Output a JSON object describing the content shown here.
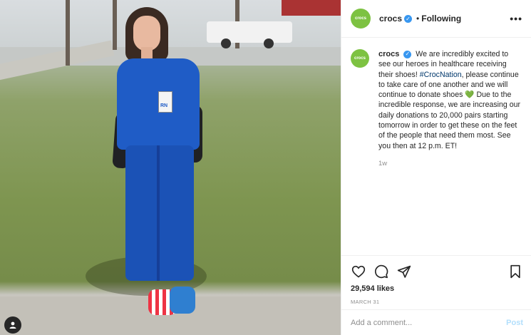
{
  "post": {
    "account": {
      "avatar_text": "crocs",
      "username": "crocs",
      "verified_glyph": "✓",
      "separator": "•",
      "follow_status": "Following"
    },
    "menu_glyph": "•••",
    "caption": {
      "username": "crocs",
      "text_before": "We are incredibly excited to see our heroes in healthcare receiving their shoes! ",
      "hashtag": "#CrocNation",
      "text_middle": ", please continue to take care of one another and we will continue to donate shoes ",
      "emoji": "💚",
      "text_after": "Due to the incredible response, we are increasing our daily donations to 20,000 pairs starting tomorrow in order to get these on the feet of the people that need them most. See you then at 12 p.m. ET!"
    },
    "age": "1w",
    "likes": "29,594 likes",
    "date": "MARCH 31",
    "comment_placeholder": "Add a comment...",
    "post_button": "Post",
    "photo_badge_text": "RN"
  },
  "icons": {
    "like": "heart-icon",
    "comment": "comment-icon",
    "share": "share-icon",
    "save": "bookmark-icon",
    "tagged_user": "user-icon"
  },
  "colors": {
    "brand_green": "#7dc242",
    "verified_blue": "#3897f0",
    "link_blue": "#00376b",
    "post_button_disabled": "#b2dffc"
  }
}
